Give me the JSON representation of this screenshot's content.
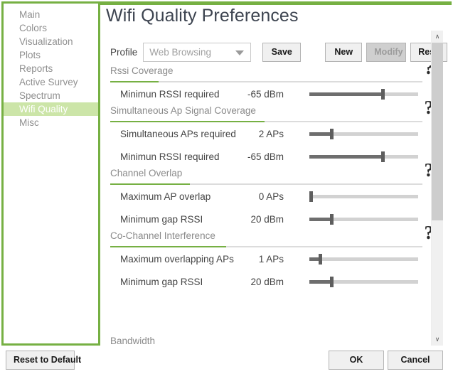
{
  "theme": {
    "accent_green": "#76b043",
    "selection_green": "#cce5a8",
    "slider_fill": "#6e6e6e",
    "slider_track": "#d2d2d2"
  },
  "sidebar": {
    "items": [
      {
        "label": "Main",
        "selected": false
      },
      {
        "label": "Colors",
        "selected": false
      },
      {
        "label": "Visualization",
        "selected": false
      },
      {
        "label": "Plots",
        "selected": false
      },
      {
        "label": "Reports",
        "selected": false
      },
      {
        "label": "Active Survey",
        "selected": false
      },
      {
        "label": "Spectrum",
        "selected": false
      },
      {
        "label": "Wifi Quality",
        "selected": true
      },
      {
        "label": "Misc",
        "selected": false
      }
    ]
  },
  "header": {
    "title": "Wifi Quality Preferences"
  },
  "toolbar": {
    "profile_label": "Profile",
    "profile_value": "Web Browsing",
    "profile_placeholder": "Web Browsing",
    "save_label": "Save",
    "new_label": "New",
    "modify_label": "Modify",
    "modify_disabled": true,
    "reset_label": "Reset"
  },
  "help_glyph": "?",
  "sections": [
    {
      "title": "Rssi Coverage",
      "accent_width": 68,
      "rows": [
        {
          "label": "Minimun RSSI required",
          "value": "-65 dBm",
          "percent": 67
        }
      ]
    },
    {
      "title": "Simultaneous Ap Signal Coverage",
      "accent_width": 217,
      "rows": [
        {
          "label": "Simultaneous APs required",
          "value": "2 APs",
          "percent": 20
        },
        {
          "label": "Minimun RSSI required",
          "value": "-65 dBm",
          "percent": 67
        }
      ]
    },
    {
      "title": "Channel Overlap",
      "accent_width": 112,
      "rows": [
        {
          "label": "Maximum AP overlap",
          "value": "0 APs",
          "percent": 1
        },
        {
          "label": "Minimum gap RSSI",
          "value": "20 dBm",
          "percent": 20
        }
      ]
    },
    {
      "title": "Co-Channel Interference",
      "accent_width": 163,
      "rows": [
        {
          "label": "Maximum overlapping APs",
          "value": "1 APs",
          "percent": 10
        },
        {
          "label": "Minimum gap RSSI",
          "value": "20 dBm",
          "percent": 20
        }
      ]
    }
  ],
  "clipped_section": {
    "title": "Bandwidth"
  },
  "scrollbar": {
    "up_arrow": "∧",
    "down_arrow": "∨"
  },
  "footer": {
    "reset_to_default_label": "Reset to Default",
    "ok_label": "OK",
    "cancel_label": "Cancel"
  }
}
